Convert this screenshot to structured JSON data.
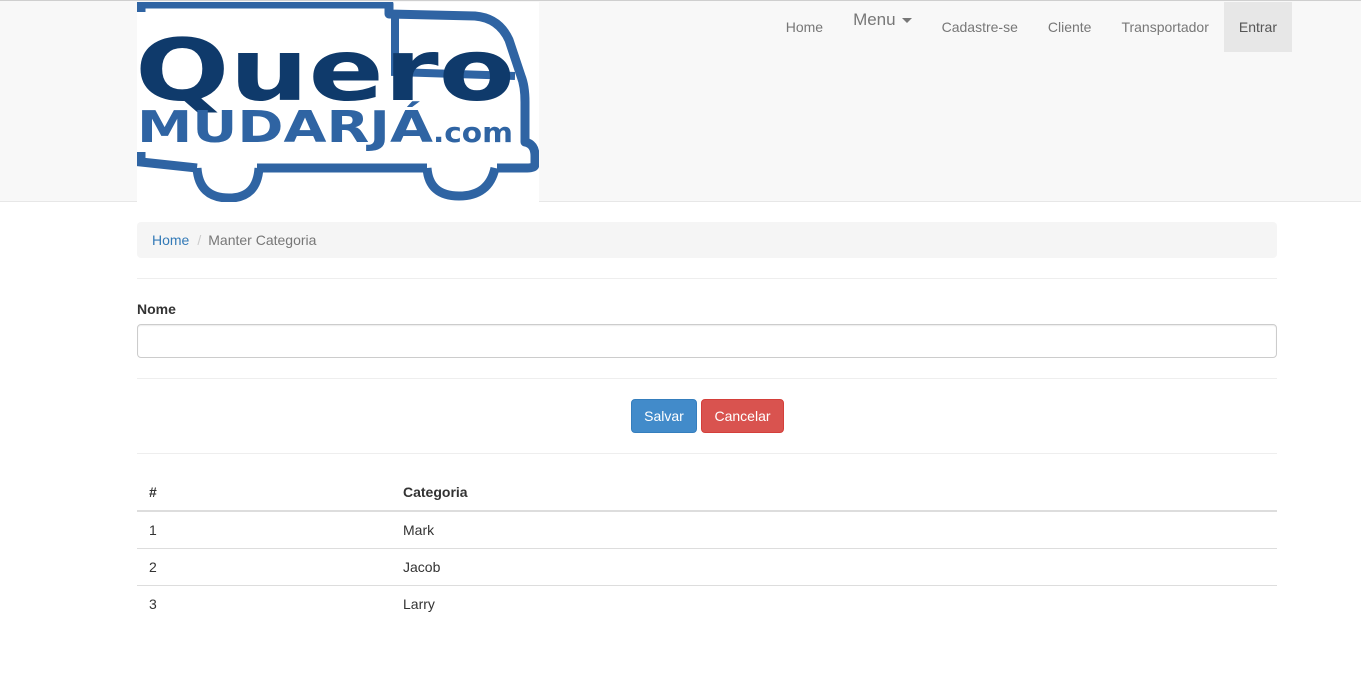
{
  "brand": {
    "logo_line1": "Quero",
    "logo_line2": "MUDARJÁ",
    "logo_suffix": ".com",
    "colors": {
      "dark": "#0f3a6b",
      "mid": "#2f64a3"
    }
  },
  "nav": {
    "items": [
      {
        "label": "Home"
      },
      {
        "label": "Menu",
        "has_dropdown": true
      },
      {
        "label": "Cadastre-se"
      },
      {
        "label": "Cliente"
      },
      {
        "label": "Transportador"
      },
      {
        "label": "Entrar",
        "active": true
      }
    ]
  },
  "breadcrumb": {
    "home": "Home",
    "separator": "/",
    "current": "Manter Categoria"
  },
  "form": {
    "name_label": "Nome",
    "name_value": "",
    "name_placeholder": ""
  },
  "buttons": {
    "save": "Salvar",
    "cancel": "Cancelar"
  },
  "table": {
    "headers": [
      "#",
      "Categoria"
    ],
    "rows": [
      [
        "1",
        "Mark"
      ],
      [
        "2",
        "Jacob"
      ],
      [
        "3",
        "Larry"
      ]
    ]
  }
}
